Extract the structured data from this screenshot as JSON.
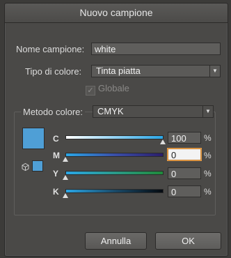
{
  "dialog": {
    "title": "Nuovo campione"
  },
  "name_field": {
    "label": "Nome campione:",
    "value": "white"
  },
  "color_type": {
    "label": "Tipo di colore:",
    "value": "Tinta piatta"
  },
  "global": {
    "label": "Globale",
    "checked": true,
    "enabled": false
  },
  "color_mode": {
    "label": "Metodo colore:",
    "value": "CMYK"
  },
  "sliders": [
    {
      "name": "C",
      "value": "100",
      "unit": "%",
      "level": 1.0
    },
    {
      "name": "M",
      "value": "0",
      "unit": "%",
      "level": 0.0
    },
    {
      "name": "Y",
      "value": "0",
      "unit": "%",
      "level": 0.0
    },
    {
      "name": "K",
      "value": "0",
      "unit": "%",
      "level": 0.0
    }
  ],
  "preview_color": "#4f9fd6",
  "buttons": {
    "cancel": "Annulla",
    "ok": "OK"
  }
}
